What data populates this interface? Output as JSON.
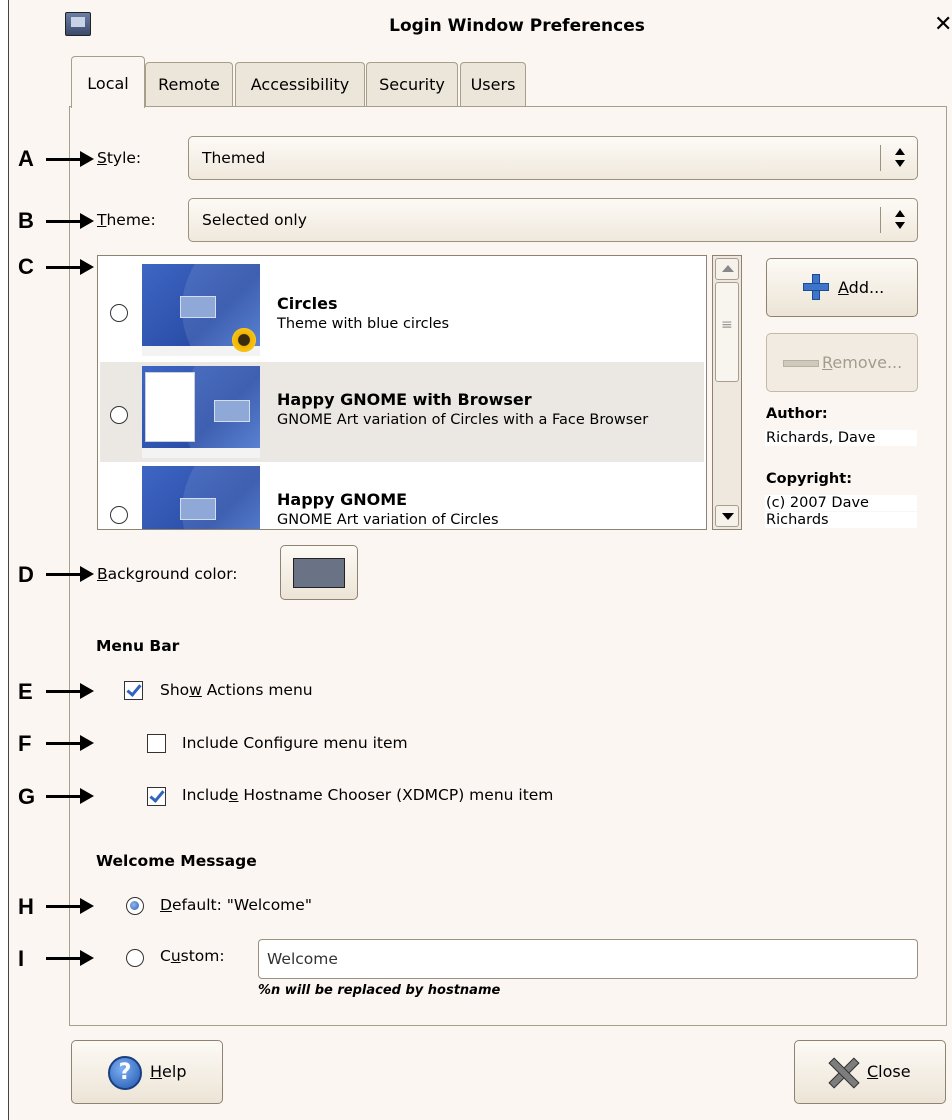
{
  "window": {
    "title": "Login Window Preferences"
  },
  "tabs": [
    "Local",
    "Remote",
    "Accessibility",
    "Security",
    "Users"
  ],
  "annotations": [
    "A",
    "B",
    "C",
    "D",
    "E",
    "F",
    "G",
    "H",
    "I"
  ],
  "style": {
    "label_key": "S",
    "label_rest": "tyle:",
    "value": "Themed"
  },
  "theme": {
    "label_key": "T",
    "label_rest": "heme:",
    "value": "Selected only"
  },
  "themes": [
    {
      "name": "Circles",
      "description": "Theme with blue circles",
      "selected": false
    },
    {
      "name": "Happy GNOME with Browser",
      "description": "GNOME Art variation of Circles with a Face Browser",
      "selected": false
    },
    {
      "name": "Happy GNOME",
      "description": "GNOME Art variation of Circles",
      "selected": false
    }
  ],
  "buttons": {
    "add_key": "A",
    "add_rest": "dd...",
    "remove_key": "R",
    "remove_rest": "emove...",
    "help_key": "H",
    "help_rest": "elp",
    "close_key": "C",
    "close_rest": "lose"
  },
  "info": {
    "author_label": "Author:",
    "author_value": "Richards, Dave",
    "copyright_label": "Copyright:",
    "copyright_line1": "(c) 2007 Dave",
    "copyright_line2": "Richards"
  },
  "background": {
    "label_key": "B",
    "label_rest": "ackground color:",
    "color": "#6a7385"
  },
  "menu_bar": {
    "heading": "Menu Bar",
    "show_actions": {
      "pre": "Sho",
      "key": "w",
      "post": " Actions menu",
      "checked": true
    },
    "include_configure": {
      "text": "Include Configure menu item",
      "checked": false
    },
    "include_chooser": {
      "pre": "Includ",
      "key": "e",
      "post": " Hostname Chooser (XDMCP) menu item",
      "checked": true
    }
  },
  "welcome": {
    "heading": "Welcome Message",
    "default_key": "D",
    "default_rest": "efault: \"Welcome\"",
    "custom_pre": "C",
    "custom_key": "u",
    "custom_post": "stom:",
    "custom_value": "Welcome",
    "hint": "%n will be replaced by hostname"
  },
  "colors": {
    "accent": "#2f64c0",
    "window_bg": "#fbf6f1"
  }
}
